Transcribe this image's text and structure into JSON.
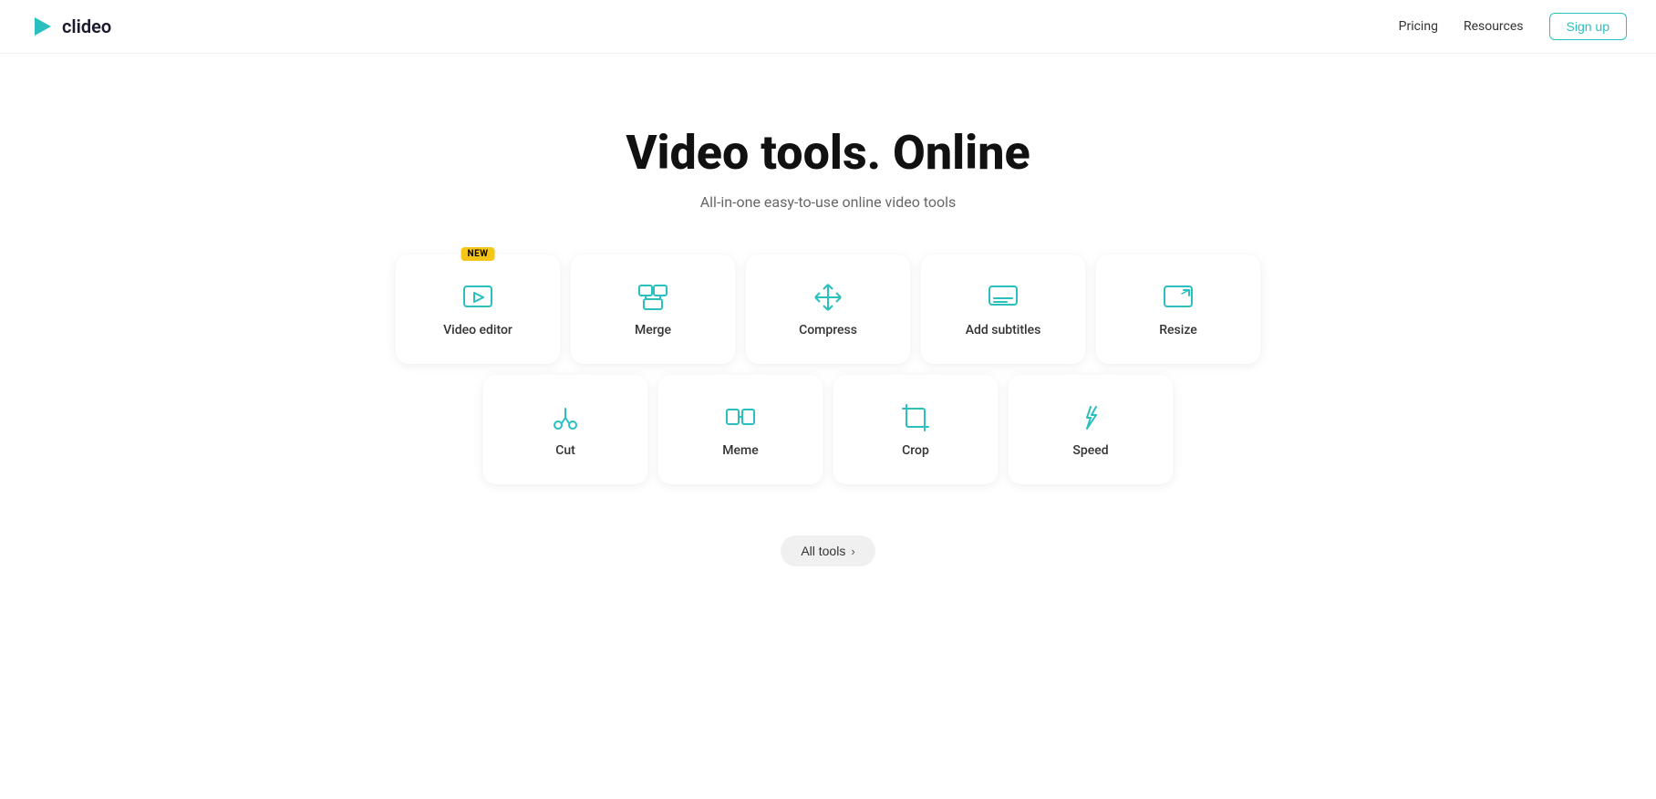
{
  "header": {
    "logo_text": "clideo",
    "nav_items": [
      "Pricing",
      "Resources"
    ],
    "sign_up_label": "Sign up"
  },
  "hero": {
    "title": "Video tools. Online",
    "subtitle": "All-in-one easy-to-use online video tools"
  },
  "tools_row1": [
    {
      "id": "video-editor",
      "label": "Video editor",
      "new": true,
      "icon": "video-editor"
    },
    {
      "id": "merge",
      "label": "Merge",
      "new": false,
      "icon": "merge"
    },
    {
      "id": "compress",
      "label": "Compress",
      "new": false,
      "icon": "compress"
    },
    {
      "id": "add-subtitles",
      "label": "Add subtitles",
      "new": false,
      "icon": "add-subtitles"
    },
    {
      "id": "resize",
      "label": "Resize",
      "new": false,
      "icon": "resize"
    }
  ],
  "tools_row2": [
    {
      "id": "cut",
      "label": "Cut",
      "new": false,
      "icon": "cut"
    },
    {
      "id": "meme",
      "label": "Meme",
      "new": false,
      "icon": "meme"
    },
    {
      "id": "crop",
      "label": "Crop",
      "new": false,
      "icon": "crop"
    },
    {
      "id": "speed",
      "label": "Speed",
      "new": false,
      "icon": "speed"
    }
  ],
  "all_tools_btn": "All tools",
  "colors": {
    "teal": "#2bbfbf",
    "badge_yellow": "#f5c518"
  }
}
